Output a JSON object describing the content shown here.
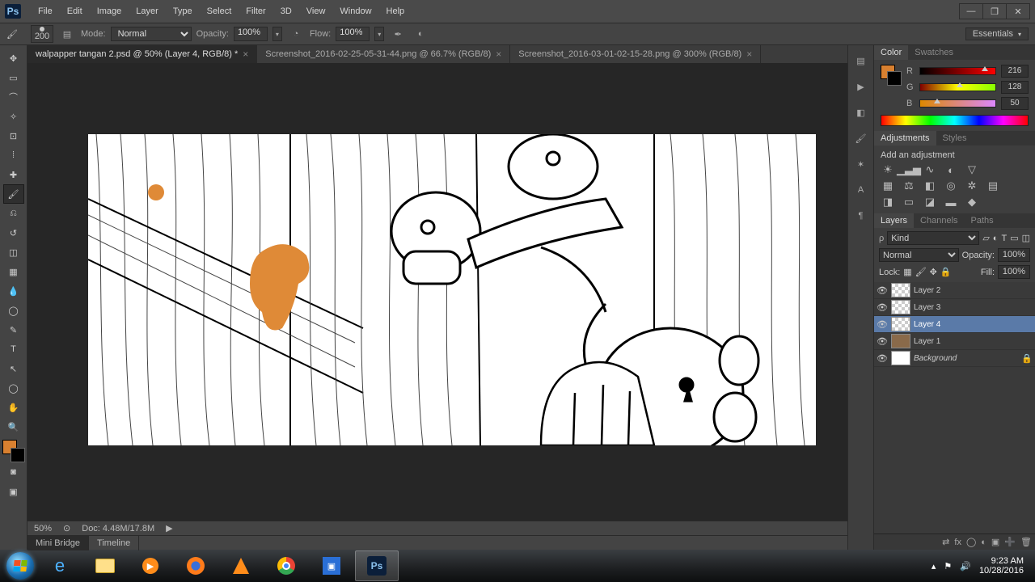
{
  "colors": {
    "accent": "#d88030",
    "panel": "#3e3e3e"
  },
  "menubar": {
    "ps": "Ps",
    "items": [
      "File",
      "Edit",
      "Image",
      "Layer",
      "Type",
      "Select",
      "Filter",
      "3D",
      "View",
      "Window",
      "Help"
    ],
    "minimize": "—",
    "maximize": "❐",
    "close": "✕"
  },
  "optbar": {
    "brush_size": "200",
    "mode_label": "Mode:",
    "mode_value": "Normal",
    "opacity_label": "Opacity:",
    "opacity_value": "100%",
    "flow_label": "Flow:",
    "flow_value": "100%",
    "workspace": "Essentials"
  },
  "tabs": [
    {
      "label": "walpapper tangan 2.psd @ 50% (Layer 4, RGB/8) *",
      "active": true
    },
    {
      "label": "Screenshot_2016-02-25-05-31-44.png @ 66.7% (RGB/8)",
      "active": false
    },
    {
      "label": "Screenshot_2016-03-01-02-15-28.png @ 300% (RGB/8)",
      "active": false
    }
  ],
  "status": {
    "zoom": "50%",
    "doc": "Doc: 4.48M/17.8M"
  },
  "footer": {
    "minibridge": "Mini Bridge",
    "timeline": "Timeline"
  },
  "colorpanel": {
    "tab_color": "Color",
    "tab_swatches": "Swatches",
    "r_label": "R",
    "r_value": "216",
    "g_label": "G",
    "g_value": "128",
    "b_label": "B",
    "b_value": "50"
  },
  "adjustments": {
    "tab_adjust": "Adjustments",
    "tab_styles": "Styles",
    "title": "Add an adjustment"
  },
  "layerspanel": {
    "tab_layers": "Layers",
    "tab_channels": "Channels",
    "tab_paths": "Paths",
    "kind": "Kind",
    "blend": "Normal",
    "opacity_label": "Opacity:",
    "opacity": "100%",
    "lock_label": "Lock:",
    "fill_label": "Fill:",
    "fill": "100%",
    "layers": [
      {
        "name": "Layer 2",
        "selected": false,
        "trans": true,
        "italic": false
      },
      {
        "name": "Layer 3",
        "selected": false,
        "trans": true,
        "italic": false
      },
      {
        "name": "Layer 4",
        "selected": true,
        "trans": true,
        "italic": false
      },
      {
        "name": "Layer 1",
        "selected": false,
        "trans": false,
        "italic": false
      },
      {
        "name": "Background",
        "selected": false,
        "trans": false,
        "italic": true
      }
    ]
  },
  "taskbar": {
    "time": "9:23 AM",
    "date": "10/28/2016"
  }
}
